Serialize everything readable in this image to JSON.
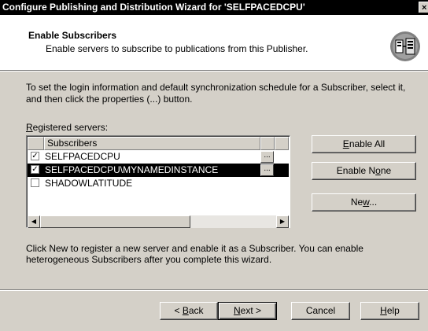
{
  "window": {
    "title": "Configure Publishing and Distribution Wizard for 'SELFPACEDCPU'",
    "close_glyph": "×"
  },
  "header": {
    "title": "Enable Subscribers",
    "subtitle": "Enable servers to subscribe to publications from this Publisher.",
    "icon": "server-wizard-icon"
  },
  "main": {
    "description": "To set the login information and default synchronization schedule for a Subscriber, select it, and then click the properties (...) button.",
    "registered_label_first": "R",
    "registered_label_rest": "egistered servers:",
    "column_header": "Subscribers",
    "rows": [
      {
        "name": "SELFPACEDCPU",
        "checked": true,
        "selected": false,
        "props": "..."
      },
      {
        "name": "SELFPACEDCPU\\MYNAMEDINSTANCE",
        "checked": true,
        "selected": true,
        "props": "..."
      },
      {
        "name": "SHADOWLATITUDE",
        "checked": false,
        "selected": false
      }
    ],
    "note": "Click New to register a new server and enable it as a Subscriber. You can enable heterogeneous Subscribers after you complete this wizard."
  },
  "side_buttons": {
    "enable_all_pre": "",
    "enable_all_key": "E",
    "enable_all_post": "nable All",
    "enable_none_pre": "Enable N",
    "enable_none_key": "o",
    "enable_none_post": "ne",
    "new_pre": "Ne",
    "new_key": "w",
    "new_post": "..."
  },
  "footer": {
    "back_pre": "< ",
    "back_key": "B",
    "back_post": "ack",
    "next_pre": "",
    "next_key": "N",
    "next_post": "ext >",
    "cancel": "Cancel",
    "help_pre": "",
    "help_key": "H",
    "help_post": "elp"
  },
  "check_glyph": "✓",
  "scroll": {
    "left_glyph": "◀",
    "right_glyph": "▶"
  }
}
